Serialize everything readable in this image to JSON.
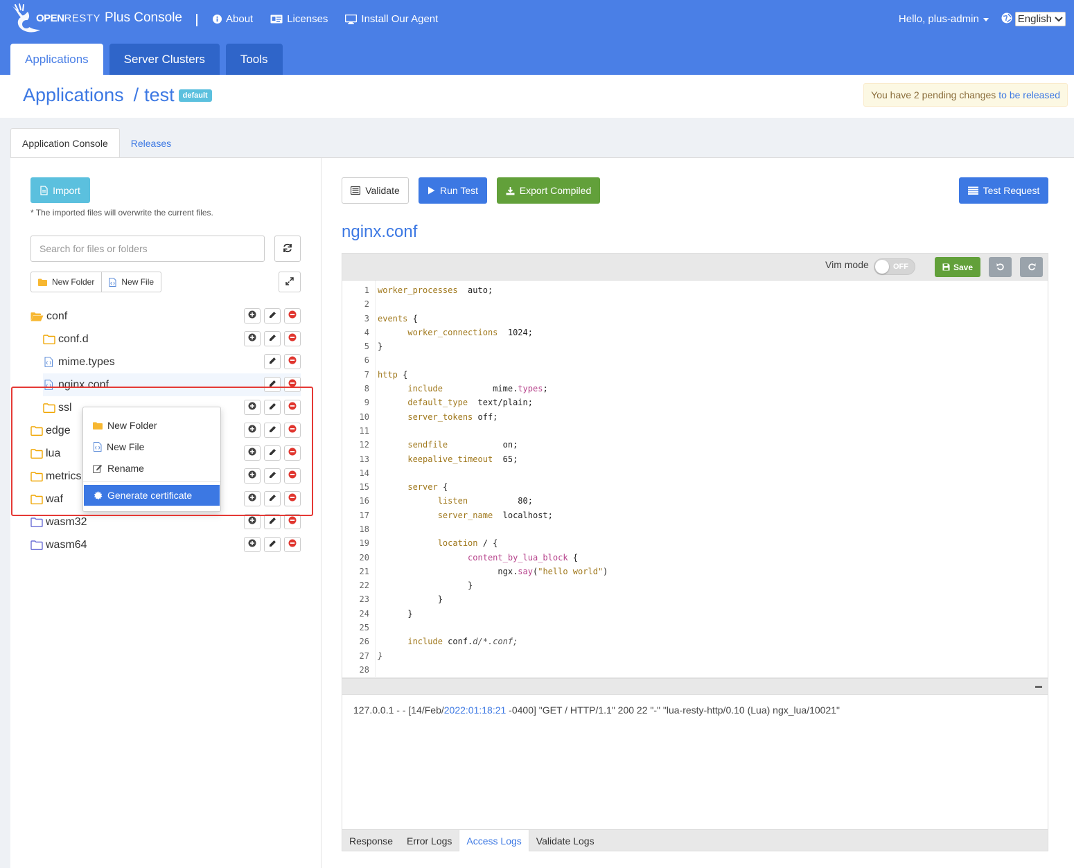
{
  "brand": {
    "op": "OPEN",
    "rest": "RESTY",
    "product": "Plus Console"
  },
  "nav": {
    "links": [
      {
        "label": "About",
        "icon": "info-icon"
      },
      {
        "label": "Licenses",
        "icon": "license-card-icon"
      },
      {
        "label": "Install Our Agent",
        "icon": "monitor-icon"
      }
    ],
    "greeting": "Hello, plus-admin",
    "language": "English"
  },
  "main_tabs": [
    {
      "label": "Applications",
      "active": true
    },
    {
      "label": "Server Clusters",
      "active": false
    },
    {
      "label": "Tools",
      "active": false
    }
  ],
  "header": {
    "section": "Applications",
    "app_name": "test",
    "badge": "default",
    "pending_text": "You have 2 pending changes",
    "pending_link": "to be released"
  },
  "console_tabs": [
    {
      "label": "Application Console",
      "active": true
    },
    {
      "label": "Releases",
      "active": false
    }
  ],
  "file_panel": {
    "import_label": "Import",
    "import_note": "* The imported files will overwrite the current files.",
    "search_placeholder": "Search for files or folders",
    "new_folder_label": "New Folder",
    "new_file_label": "New File",
    "tree": [
      {
        "name": "conf",
        "type": "folder-open",
        "depth": 0
      },
      {
        "name": "conf.d",
        "type": "folder",
        "depth": 1
      },
      {
        "name": "mime.types",
        "type": "file",
        "depth": 1
      },
      {
        "name": "nginx.conf",
        "type": "file",
        "depth": 1,
        "selected": true
      },
      {
        "name": "ssl",
        "type": "folder",
        "depth": 1
      },
      {
        "name": "edge",
        "type": "folder",
        "depth": 0
      },
      {
        "name": "lua",
        "type": "folder",
        "depth": 0
      },
      {
        "name": "metrics",
        "type": "folder",
        "depth": 0
      },
      {
        "name": "waf",
        "type": "folder",
        "depth": 0
      },
      {
        "name": "wasm32",
        "type": "folder",
        "depth": 0
      },
      {
        "name": "wasm64",
        "type": "folder",
        "depth": 0
      }
    ]
  },
  "context_menu": {
    "items": [
      {
        "label": "New Folder",
        "icon": "folder-icon"
      },
      {
        "label": "New File",
        "icon": "file-code-icon"
      },
      {
        "label": "Rename",
        "icon": "edit-icon"
      }
    ],
    "action": {
      "label": "Generate certificate",
      "icon": "certificate-icon"
    }
  },
  "editor": {
    "validate_label": "Validate",
    "run_test_label": "Run Test",
    "export_label": "Export Compiled",
    "test_request_label": "Test Request",
    "file_title": "nginx.conf",
    "vim_label": "Vim mode",
    "vim_state": "OFF",
    "save_label": "Save"
  },
  "log": {
    "pre": "127.0.0.1 - - [14/Feb/",
    "ts": "2022:01:18:21",
    "post": " -0400] \"GET / HTTP/1.1\" 200 22 \"-\" \"lua-resty-http/0.10 (Lua) ngx_lua/10021\"",
    "tabs": [
      {
        "label": "Response",
        "active": false
      },
      {
        "label": "Error Logs",
        "active": false
      },
      {
        "label": "Access Logs",
        "active": true
      },
      {
        "label": "Validate Logs",
        "active": false
      }
    ]
  },
  "colors": {
    "brand_blue": "#4a7fe6",
    "primary": "#3c78e3",
    "success": "#62a03a",
    "info": "#5bc0de",
    "danger": "#e53935",
    "folder": "#f7b731"
  }
}
